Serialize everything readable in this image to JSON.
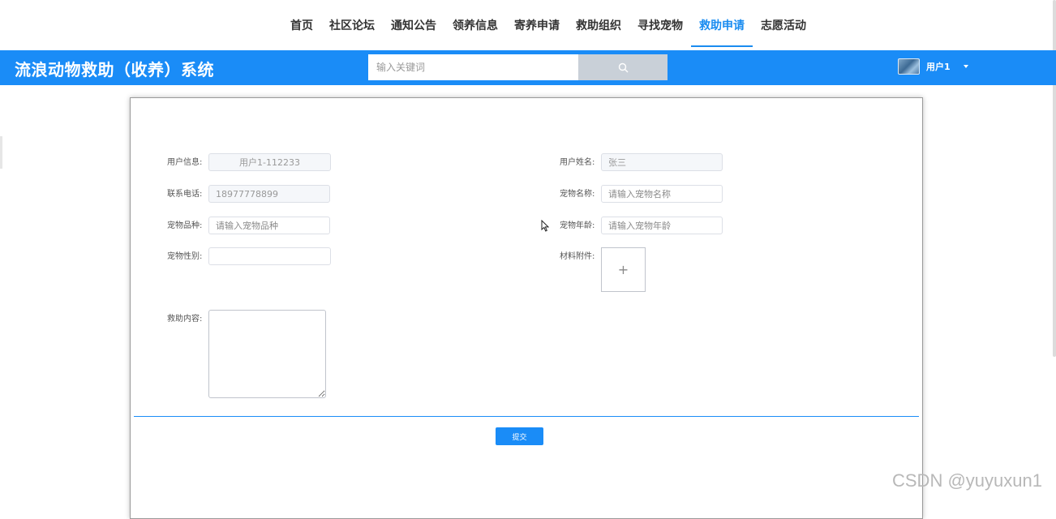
{
  "nav": {
    "items": [
      {
        "label": "首页"
      },
      {
        "label": "社区论坛"
      },
      {
        "label": "通知公告"
      },
      {
        "label": "领养信息"
      },
      {
        "label": "寄养申请"
      },
      {
        "label": "救助组织"
      },
      {
        "label": "寻找宠物"
      },
      {
        "label": "救助申请",
        "active": true
      },
      {
        "label": "志愿活动"
      }
    ],
    "active_color": "#1a8cf0"
  },
  "header": {
    "title": "流浪动物救助（收养）系统",
    "bg_color": "#1a8cf7",
    "search": {
      "placeholder": "输入关键词",
      "button_icon": "search-icon"
    },
    "user": {
      "name": "用户1",
      "dropdown_icon": "caret-down-icon"
    }
  },
  "form": {
    "user_info": {
      "label": "用户信息:",
      "value": "用户1-112233"
    },
    "user_name": {
      "label": "用户姓名:",
      "value": "张三"
    },
    "phone": {
      "label": "联系电话:",
      "value": "18977778899"
    },
    "pet_name": {
      "label": "宠物名称:",
      "placeholder": "请输入宠物名称"
    },
    "pet_breed": {
      "label": "宠物品种:",
      "placeholder": "请输入宠物品种"
    },
    "pet_age": {
      "label": "宠物年龄:",
      "placeholder": "请输入宠物年龄"
    },
    "pet_gender": {
      "label": "宠物性别:",
      "value": ""
    },
    "attachment": {
      "label": "材料附件:",
      "upload_symbol": "+"
    },
    "content": {
      "label": "救助内容:",
      "value": ""
    },
    "submit_label": "提交"
  },
  "watermark": "CSDN @yuyuxun1"
}
